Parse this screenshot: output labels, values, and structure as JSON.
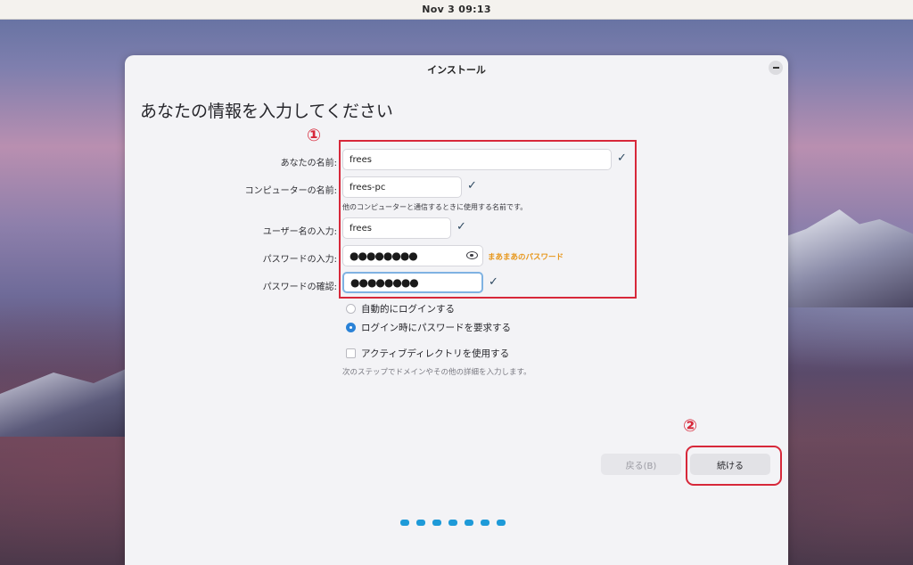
{
  "topbar": {
    "clock": "Nov 3  09:13"
  },
  "window": {
    "title": "インストール",
    "heading": "あなたの情報を入力してください"
  },
  "form": {
    "name_label": "あなたの名前:",
    "name_value": "frees",
    "computer_label": "コンピューターの名前:",
    "computer_value": "frees-pc",
    "computer_hint": "他のコンピューターと通信するときに使用する名前です。",
    "username_label": "ユーザー名の入力:",
    "username_value": "frees",
    "password_label": "パスワードの入力:",
    "password_value": "●●●●●●●●",
    "password_strength": "まあまあのパスワード",
    "confirm_label": "パスワードの確認:",
    "confirm_value": "●●●●●●●●"
  },
  "options": {
    "auto_login": "自動的にログインする",
    "require_password": "ログイン時にパスワードを要求する",
    "active_directory": "アクティブディレクトリを使用する",
    "ad_hint": "次のステップでドメインやその他の詳細を入力します。"
  },
  "buttons": {
    "back": "戻る(B)",
    "continue": "続ける"
  },
  "annotations": {
    "marker_1": "①",
    "marker_2": "②",
    "color": "#d7283a"
  },
  "progress": {
    "total_steps": 7
  }
}
